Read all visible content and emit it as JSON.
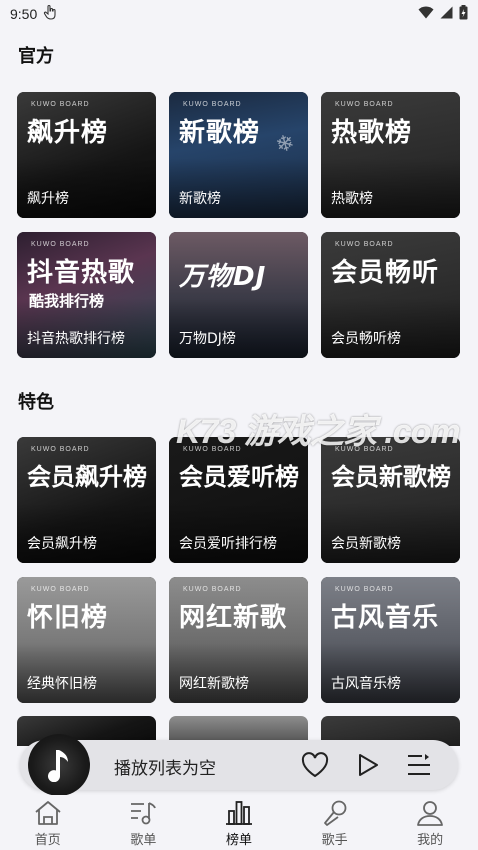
{
  "status": {
    "time": "9:50"
  },
  "sections": [
    {
      "title": "官方",
      "cards": [
        {
          "brand": "KUWO BOARD",
          "big": "飙升榜",
          "sub": "",
          "caption": "飙升榜",
          "bg": "bg-dark1"
        },
        {
          "brand": "KUWO BOARD",
          "big": "新歌榜",
          "sub": "",
          "caption": "新歌榜",
          "bg": "bg-blue"
        },
        {
          "brand": "KUWO BOARD",
          "big": "热歌榜",
          "sub": "",
          "caption": "热歌榜",
          "bg": "bg-gray"
        },
        {
          "brand": "KUWO BOARD",
          "big": "抖音热歌",
          "sub": "酷我排行榜",
          "caption": "抖音热歌排行榜",
          "bg": "bg-purple"
        },
        {
          "brand": "",
          "big": "万物DJ",
          "sub": "",
          "caption": "万物DJ榜",
          "bg": "bg-sunset"
        },
        {
          "brand": "KUWO BOARD",
          "big": "会员畅听",
          "sub": "",
          "caption": "会员畅听榜",
          "bg": "bg-gray"
        }
      ]
    },
    {
      "title": "特色",
      "cards": [
        {
          "brand": "KUWO BOARD",
          "big": "会员飙升榜",
          "sub": "",
          "caption": "会员飙升榜",
          "bg": "bg-dark1"
        },
        {
          "brand": "KUWO BOARD",
          "big": "会员爱听榜",
          "sub": "",
          "caption": "会员爱听排行榜",
          "bg": "bg-black"
        },
        {
          "brand": "KUWO BOARD",
          "big": "会员新歌榜",
          "sub": "",
          "caption": "会员新歌榜",
          "bg": "bg-gray"
        },
        {
          "brand": "KUWO BOARD",
          "big": "怀旧榜",
          "sub": "",
          "caption": "经典怀旧榜",
          "bg": "bg-light1"
        },
        {
          "brand": "KUWO BOARD",
          "big": "网红新歌",
          "sub": "",
          "caption": "网红新歌榜",
          "bg": "bg-light2"
        },
        {
          "brand": "KUWO BOARD",
          "big": "古风音乐",
          "sub": "",
          "caption": "古风音乐榜",
          "bg": "bg-light3"
        }
      ]
    }
  ],
  "watermark": "K73 游戏之家 .com",
  "player": {
    "text": "播放列表为空"
  },
  "tabs": [
    {
      "label": "首页",
      "icon": "home-icon"
    },
    {
      "label": "歌单",
      "icon": "playlist-icon"
    },
    {
      "label": "榜单",
      "icon": "chart-icon",
      "active": true
    },
    {
      "label": "歌手",
      "icon": "singer-icon"
    },
    {
      "label": "我的",
      "icon": "profile-icon"
    }
  ]
}
